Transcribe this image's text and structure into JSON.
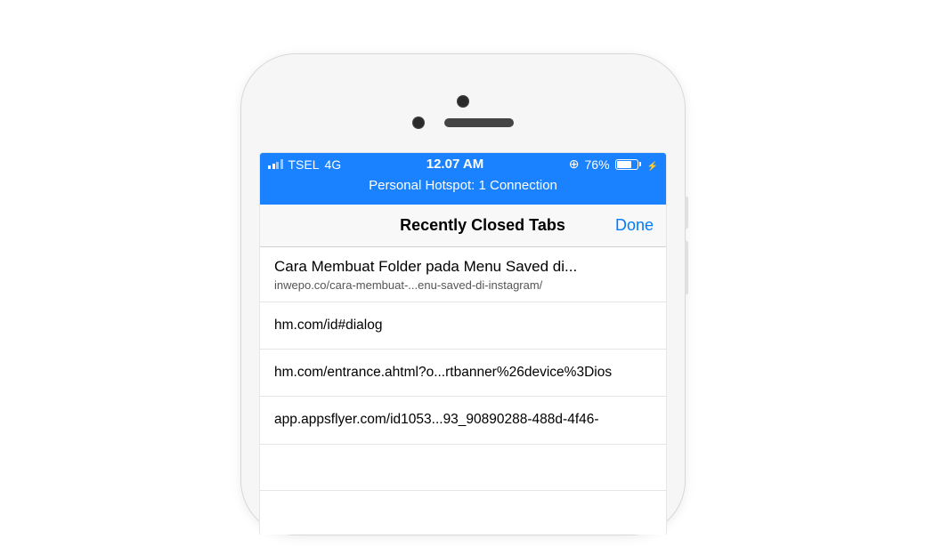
{
  "status": {
    "carrier": "TSEL",
    "network": "4G",
    "time": "12.07 AM",
    "battery_pct": "76%",
    "hotspot": "Personal Hotspot: 1 Connection"
  },
  "nav": {
    "title": "Recently Closed Tabs",
    "done": "Done"
  },
  "tabs": [
    {
      "title": "Cara Membuat Folder pada Menu Saved di...",
      "url": "inwepo.co/cara-membuat-...enu-saved-di-instagram/"
    },
    {
      "title": "hm.com/id#dialog",
      "url": ""
    },
    {
      "title": "hm.com/entrance.ahtml?o...rtbanner%26device%3Dios",
      "url": ""
    },
    {
      "title": "app.appsflyer.com/id1053...93_90890288-488d-4f46-",
      "url": ""
    }
  ]
}
